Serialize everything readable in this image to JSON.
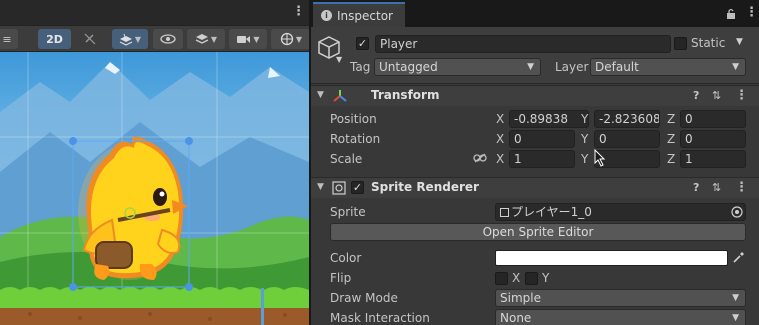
{
  "scene": {
    "toolbar": {
      "mode_2d": "2D",
      "icons": [
        "hamburger-icon",
        "lighting-icon",
        "layers-icon",
        "visibility-icon",
        "render-mode-icon",
        "camera-icon",
        "gizmo-icon"
      ]
    }
  },
  "inspector": {
    "tab_label": "Inspector",
    "object": {
      "active": true,
      "name": "Player",
      "static_label": "Static",
      "tag_label": "Tag",
      "tag_value": "Untagged",
      "layer_label": "Layer",
      "layer_value": "Default"
    },
    "transform": {
      "title": "Transform",
      "position_label": "Position",
      "rotation_label": "Rotation",
      "scale_label": "Scale",
      "axis_x": "X",
      "axis_y": "Y",
      "axis_z": "Z",
      "position": {
        "x": "-0.89838",
        "y": "-2.823608",
        "z": "0"
      },
      "rotation": {
        "x": "0",
        "y": "0",
        "z": "0"
      },
      "scale": {
        "x": "1",
        "y": "",
        "z": "1"
      }
    },
    "sprite_renderer": {
      "enabled": true,
      "title": "Sprite Renderer",
      "sprite_label": "Sprite",
      "sprite_value": "プレイヤー1_0",
      "open_editor_label": "Open Sprite Editor",
      "color_label": "Color",
      "color_value": "#ffffff",
      "flip_label": "Flip",
      "flip_x": "X",
      "flip_y": "Y",
      "draw_mode_label": "Draw Mode",
      "draw_mode_value": "Simple",
      "mask_label": "Mask Interaction",
      "mask_value": "None"
    }
  }
}
